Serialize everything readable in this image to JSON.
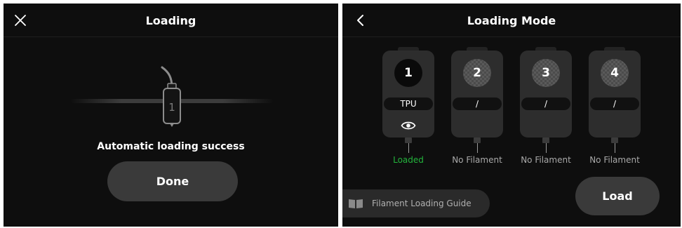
{
  "left": {
    "title": "Loading",
    "slot_number": "1",
    "message": "Automatic loading success",
    "done_label": "Done"
  },
  "right": {
    "title": "Loading Mode",
    "slots": [
      {
        "number": "1",
        "label": "TPU",
        "status": "Loaded",
        "filled": true
      },
      {
        "number": "2",
        "label": "/",
        "status": "No Filament",
        "filled": false
      },
      {
        "number": "3",
        "label": "/",
        "status": "No Filament",
        "filled": false
      },
      {
        "number": "4",
        "label": "/",
        "status": "No Filament",
        "filled": false
      }
    ],
    "guide_label": "Filament Loading Guide",
    "load_label": "Load"
  },
  "colors": {
    "background": "#0e0e0e",
    "button": "#3a3a3a",
    "loaded_status": "#23b43c",
    "slot_body": "#2d2d2d"
  },
  "icons": {
    "close": "close-icon",
    "back": "chevron-left-icon",
    "view": "eye-icon",
    "guide": "book-icon"
  }
}
